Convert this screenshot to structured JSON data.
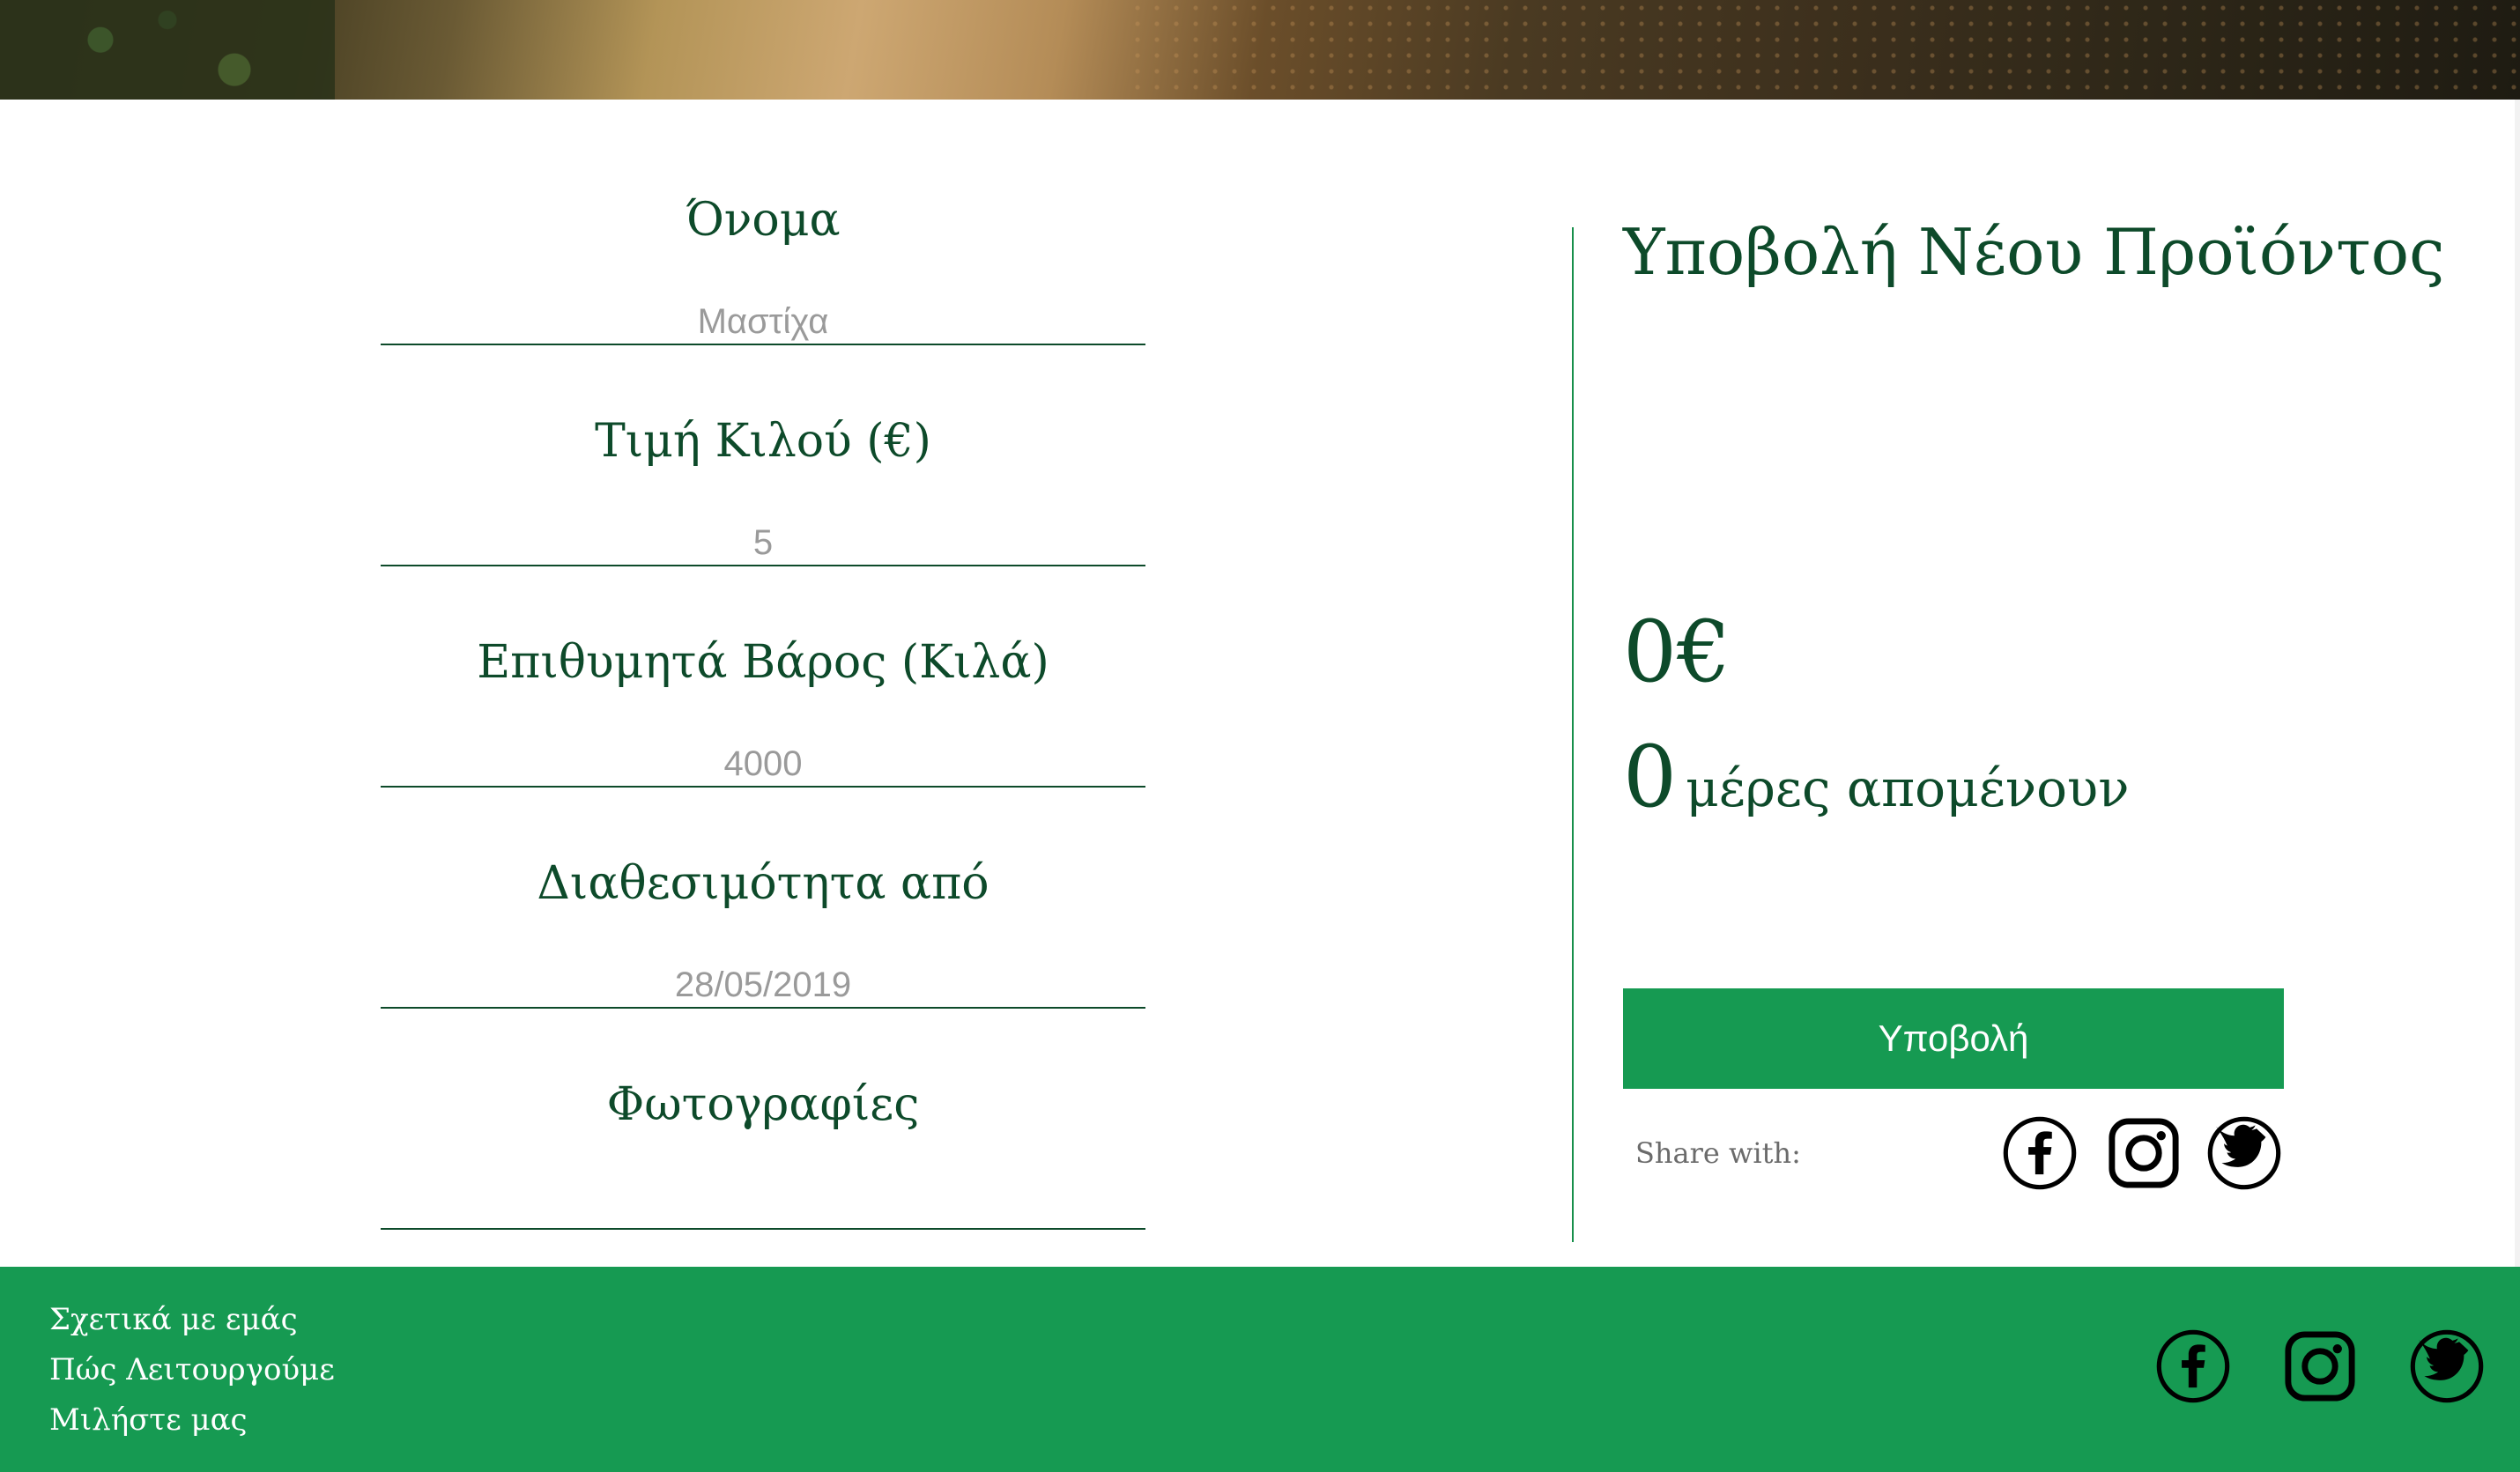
{
  "form": {
    "fields": [
      {
        "label": "Όνομα",
        "placeholder": "Μαστίχα"
      },
      {
        "label": "Τιμή Κιλού (€)",
        "placeholder": "5"
      },
      {
        "label": "Επιθυμητά Βάρος (Κιλά)",
        "placeholder": "4000"
      },
      {
        "label": "Διαθεσιμότητα από",
        "placeholder": "28/05/2019"
      },
      {
        "label": "Φωτογραφίες",
        "placeholder": ""
      }
    ]
  },
  "panel": {
    "title": "Υποβολή Νέου Προϊόντος",
    "amount": "0€",
    "days_count": "0",
    "days_text": "μέρες απομένουν",
    "submit_label": "Υποβολή",
    "share_label": "Share with:"
  },
  "social_icons": [
    "facebook-icon",
    "instagram-icon",
    "twitter-icon"
  ],
  "footer": {
    "links": [
      "Σχετικά με εμάς",
      "Πώς Λειτουργούμε",
      "Μιλήστε μας"
    ]
  },
  "colors": {
    "brand_green": "#169a52",
    "text_dark_green": "#0d4a2a",
    "placeholder_gray": "#9a9a9a"
  }
}
